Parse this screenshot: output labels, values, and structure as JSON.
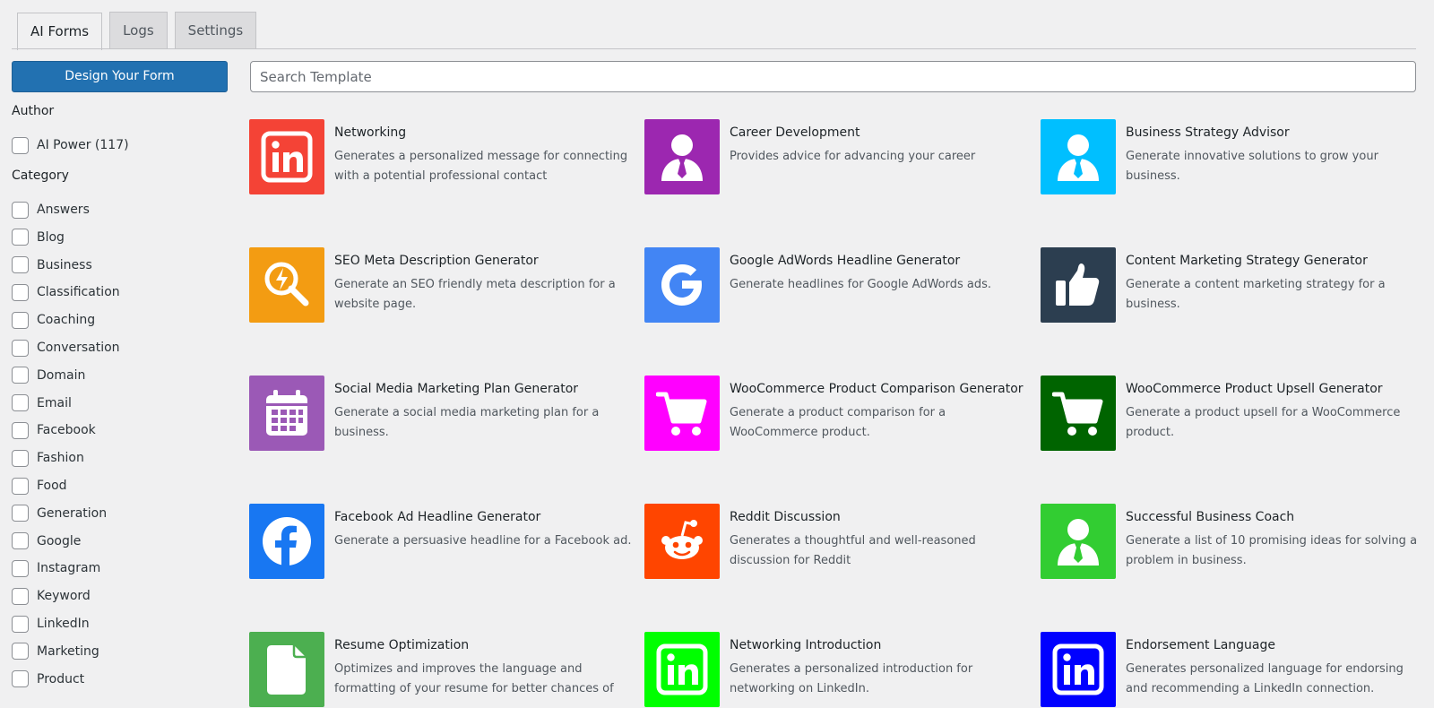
{
  "tabs": [
    {
      "label": "AI Forms"
    },
    {
      "label": "Logs"
    },
    {
      "label": "Settings"
    }
  ],
  "sidebar": {
    "design_button": "Design Your Form",
    "author_heading": "Author",
    "authors": [
      {
        "label": "AI Power (117)"
      }
    ],
    "category_heading": "Category",
    "categories": [
      {
        "label": "Answers"
      },
      {
        "label": "Blog"
      },
      {
        "label": "Business"
      },
      {
        "label": "Classification"
      },
      {
        "label": "Coaching"
      },
      {
        "label": "Conversation"
      },
      {
        "label": "Domain"
      },
      {
        "label": "Email"
      },
      {
        "label": "Facebook"
      },
      {
        "label": "Fashion"
      },
      {
        "label": "Food"
      },
      {
        "label": "Generation"
      },
      {
        "label": "Google"
      },
      {
        "label": "Instagram"
      },
      {
        "label": "Keyword"
      },
      {
        "label": "LinkedIn"
      },
      {
        "label": "Marketing"
      },
      {
        "label": "Product"
      }
    ]
  },
  "search": {
    "placeholder": "Search Template",
    "value": ""
  },
  "templates": [
    {
      "title": "Networking",
      "description": "Generates a personalized message for connecting with a potential professional contact",
      "icon": "linkedin-icon",
      "color": "#f44336"
    },
    {
      "title": "Career Development",
      "description": "Provides advice for advancing your career",
      "icon": "businessman-icon",
      "color": "#9c27b0"
    },
    {
      "title": "Business Strategy Advisor",
      "description": "Generate innovative solutions to grow your business.",
      "icon": "businessman-icon",
      "color": "#00bfff"
    },
    {
      "title": "SEO Meta Description Generator",
      "description": "Generate an SEO friendly meta description for a website page.",
      "icon": "seo-search-icon",
      "color": "#f39c12"
    },
    {
      "title": "Google AdWords Headline Generator",
      "description": "Generate headlines for Google AdWords ads.",
      "icon": "google-icon",
      "color": "#4285f4"
    },
    {
      "title": "Content Marketing Strategy Generator",
      "description": "Generate a content marketing strategy for a business.",
      "icon": "thumbs-up-icon",
      "color": "#2c3e50"
    },
    {
      "title": "Social Media Marketing Plan Generator",
      "description": "Generate a social media marketing plan for a business.",
      "icon": "calendar-icon",
      "color": "#9b59b6"
    },
    {
      "title": "WooCommerce Product Comparison Generator",
      "description": "Generate a product comparison for a WooCommerce product.",
      "icon": "shopping-cart-icon",
      "color": "#ff00ff"
    },
    {
      "title": "WooCommerce Product Upsell Generator",
      "description": "Generate a product upsell for a WooCommerce product.",
      "icon": "shopping-cart-icon",
      "color": "#006400"
    },
    {
      "title": "Facebook Ad Headline Generator",
      "description": "Generate a persuasive headline for a Facebook ad.",
      "icon": "facebook-icon",
      "color": "#1877f2"
    },
    {
      "title": "Reddit Discussion",
      "description": "Generates a thoughtful and well-reasoned discussion for Reddit",
      "icon": "reddit-icon",
      "color": "#ff4500"
    },
    {
      "title": "Successful Business Coach",
      "description": "Generate a list of 10 promising ideas for solving a problem in business.",
      "icon": "businessman-icon",
      "color": "#32cd32"
    },
    {
      "title": "Resume Optimization",
      "description": "Optimizes and improves the language and formatting of your resume for better chances of",
      "icon": "document-icon",
      "color": "#4caf50"
    },
    {
      "title": "Networking Introduction",
      "description": "Generates a personalized introduction for networking on LinkedIn.",
      "icon": "linkedin-icon",
      "color": "#00ff00"
    },
    {
      "title": "Endorsement Language",
      "description": "Generates personalized language for endorsing and recommending a LinkedIn connection.",
      "icon": "linkedin-icon",
      "color": "#0000ff"
    }
  ]
}
